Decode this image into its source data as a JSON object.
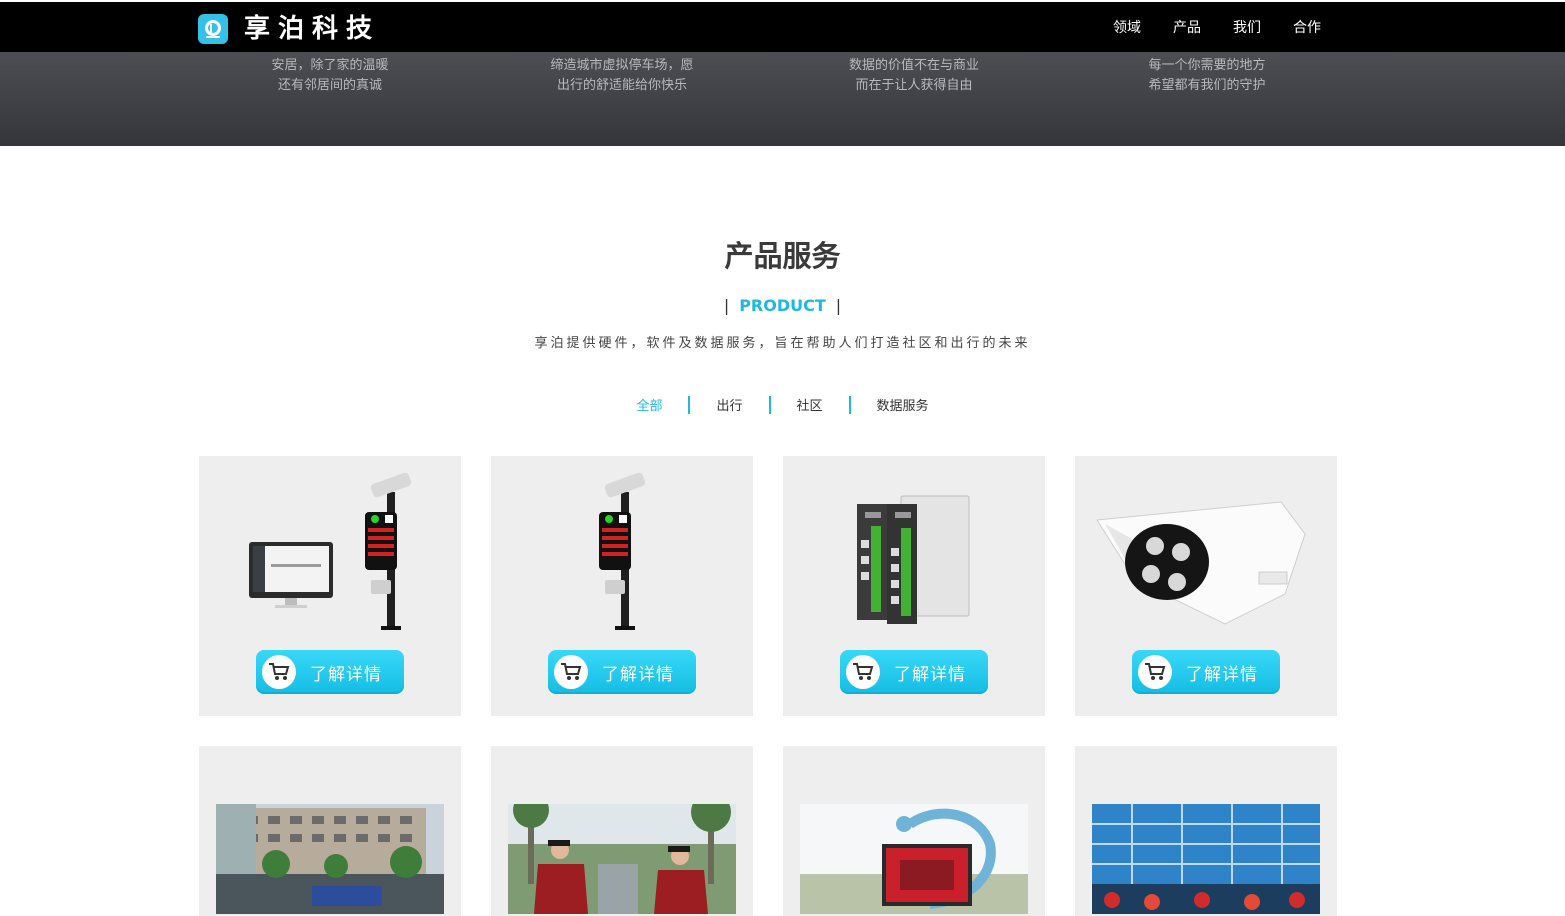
{
  "header": {
    "logo_text": "享泊科技",
    "nav": [
      "领域",
      "产品",
      "我们",
      "合作"
    ]
  },
  "banner": {
    "slogans": [
      {
        "line1": "安居，除了家的温暖",
        "line2": "还有邻居间的真诚"
      },
      {
        "line1": "缔造城市虚拟停车场，愿",
        "line2": "出行的舒适能给你快乐"
      },
      {
        "line1": "数据的价值不在与商业",
        "line2": "而在于让人获得自由"
      },
      {
        "line1": "每一个你需要的地方",
        "line2": "希望都有我们的守护"
      }
    ]
  },
  "products": {
    "title": "产品服务",
    "label": "PRODUCT",
    "description": "享泊提供硬件，软件及数据服务，旨在帮助人们打造社区和出行的未来",
    "filters": [
      "全部",
      "出行",
      "社区",
      "数据服务"
    ],
    "active_filter": 0,
    "button_label": "了解详情",
    "accent_color": "#1eb8e0"
  },
  "icons": {
    "cart": "shopping-cart-icon",
    "logo": "parking-logo-icon"
  }
}
